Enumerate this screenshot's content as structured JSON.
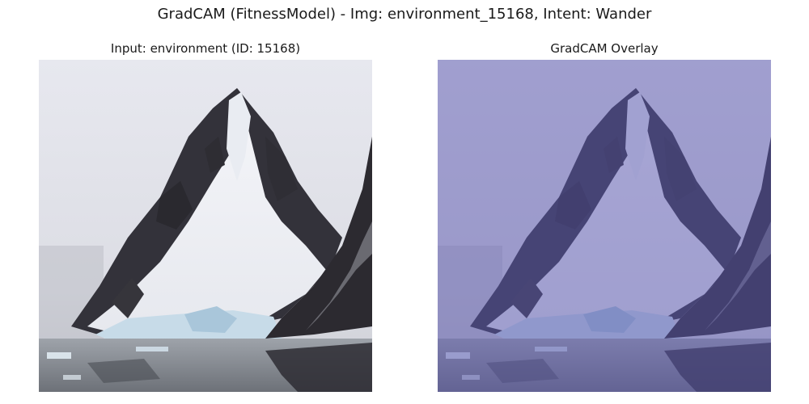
{
  "figure": {
    "title": "GradCAM (FitnessModel) - Img: environment_15168, Intent: Wander"
  },
  "panels": [
    {
      "title": "Input: environment (ID: 15168)",
      "image": "snowy-mountain-photo"
    },
    {
      "title": "GradCAM Overlay",
      "image": "snowy-mountain-photo-with-uniform-purple-heatmap-overlay"
    }
  ],
  "colors": {
    "sky": "#e4e5ec",
    "rock": "#2b2a30",
    "snow": "#f0f2f6",
    "ice": "#c9dce8",
    "water": "#8e9399",
    "overlay": "#8a88c8"
  }
}
